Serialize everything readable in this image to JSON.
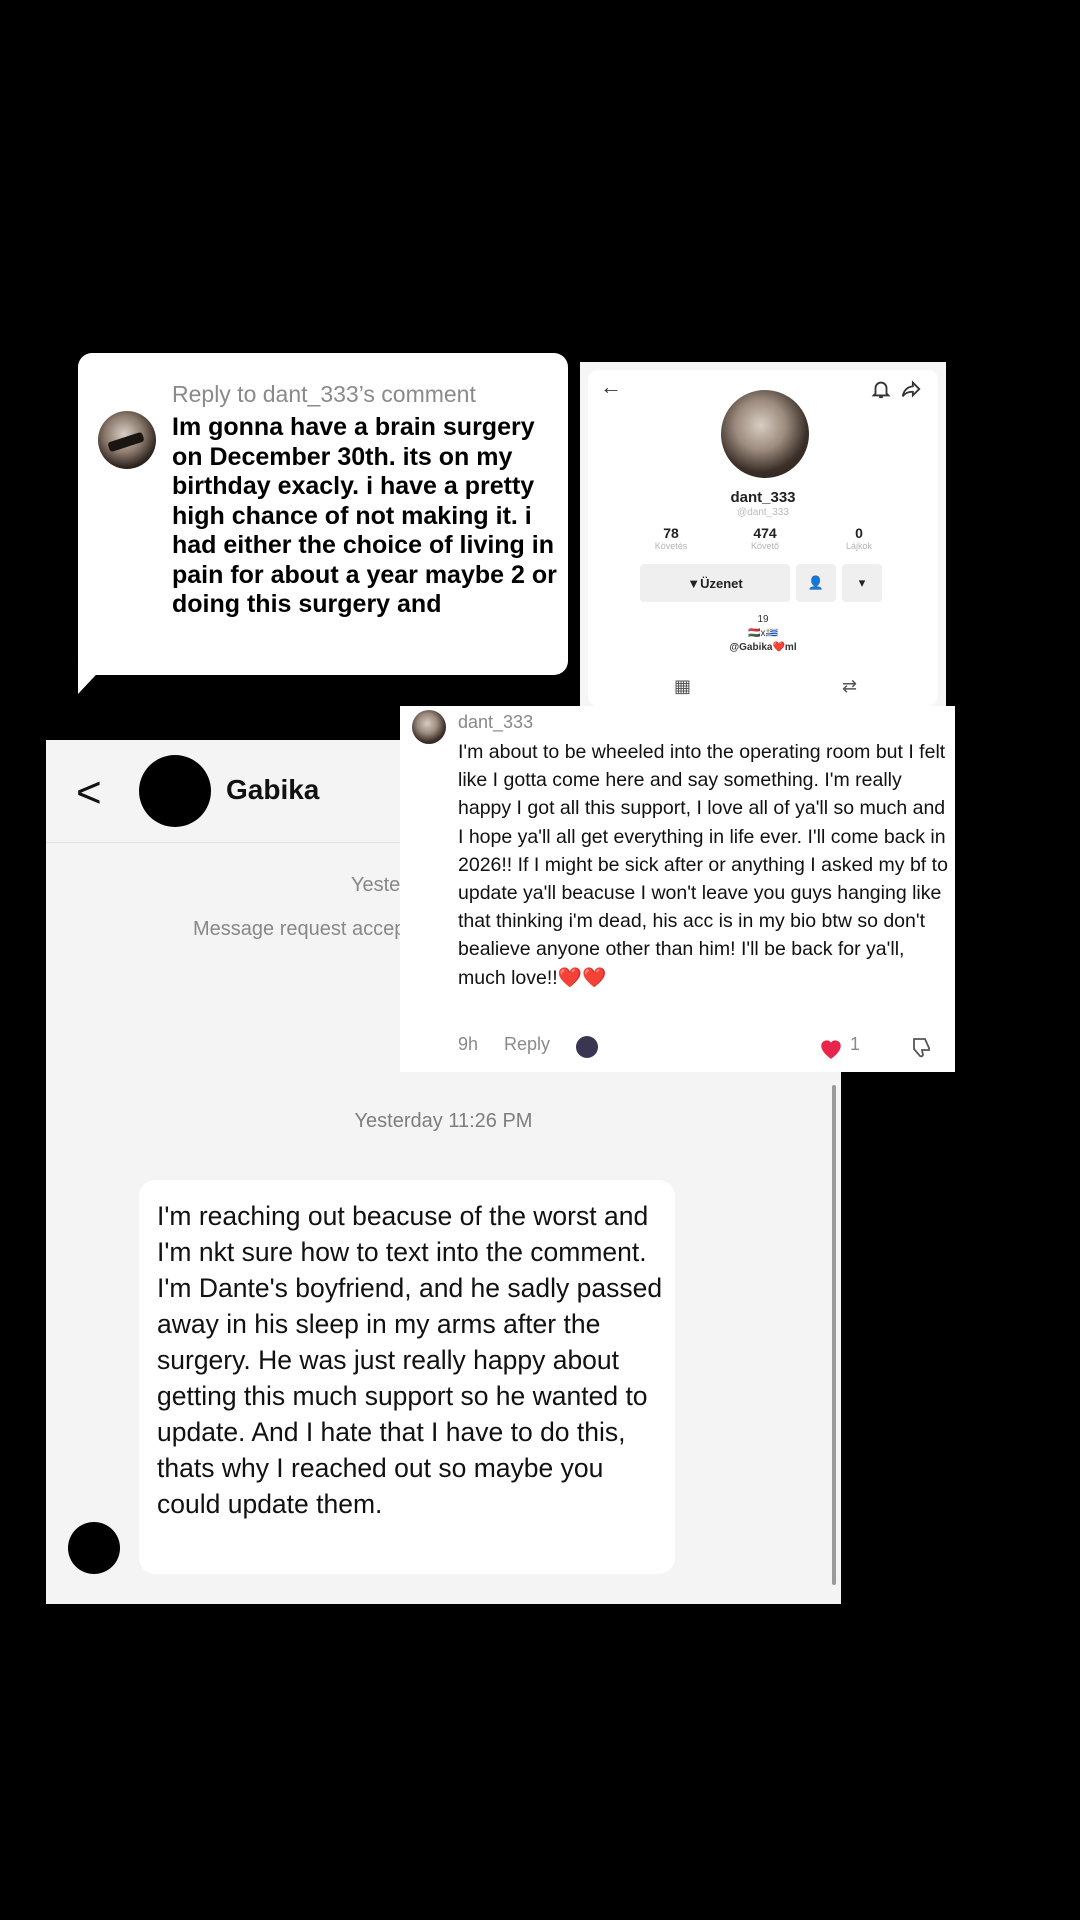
{
  "reply_card": {
    "title": "Reply to dant_333’s comment",
    "text": "Im gonna have a brain surgery on December 30th. its on my birthday exacly. i have a pretty high chance of not making it. i had either the choice of living in pain for about a year maybe 2 or doing this surgery and"
  },
  "profile": {
    "icons": {
      "back": "arrow-left-icon",
      "bell": "bell-icon",
      "share": "share-icon"
    },
    "name": "dant_333",
    "handle": "@dant_333",
    "stats": [
      {
        "value": "78",
        "label": "Követés"
      },
      {
        "value": "474",
        "label": "Követő"
      },
      {
        "value": "0",
        "label": "Lájkok"
      }
    ],
    "message_button": "Üzenet",
    "bio_line1": "19",
    "bio_line2": "🇭🇺x🇺🇾",
    "bio_line3": "@Gabika❤️ml"
  },
  "chat": {
    "contact_name": "Gabika",
    "system_time": "Yesterday",
    "system_note": "Message request accepted",
    "timestamp": "Yesterday 11:26 PM",
    "message": "I'm reaching out beacuse of the worst and I'm nkt sure how to text into the comment. I'm Dante's boyfriend, and he sadly passed away in his sleep in my arms after the surgery. He was just really happy about getting this much support so he wanted to update. And I hate that I have to do this, thats why I reached out so maybe you could update them."
  },
  "comment": {
    "username": "dant_333",
    "text": "I'm about to be wheeled into the operating room but I felt like I gotta come here and say something. I'm really happy I got all this support, I love all of ya'll so much and I hope ya'll all get everything in life ever. I'll come back in 2026!! If I might be sick after or anything I asked my bf to update ya'll beacuse I won't leave you guys hanging like that thinking i'm dead, his acc is in my bio btw so don't bealieve anyone other than him! I'll be back for ya'll, much love!!❤️❤️",
    "time": "9h",
    "reply_label": "Reply",
    "like_count": "1"
  },
  "colors": {
    "like": "#e8254b",
    "background": "#000000"
  }
}
